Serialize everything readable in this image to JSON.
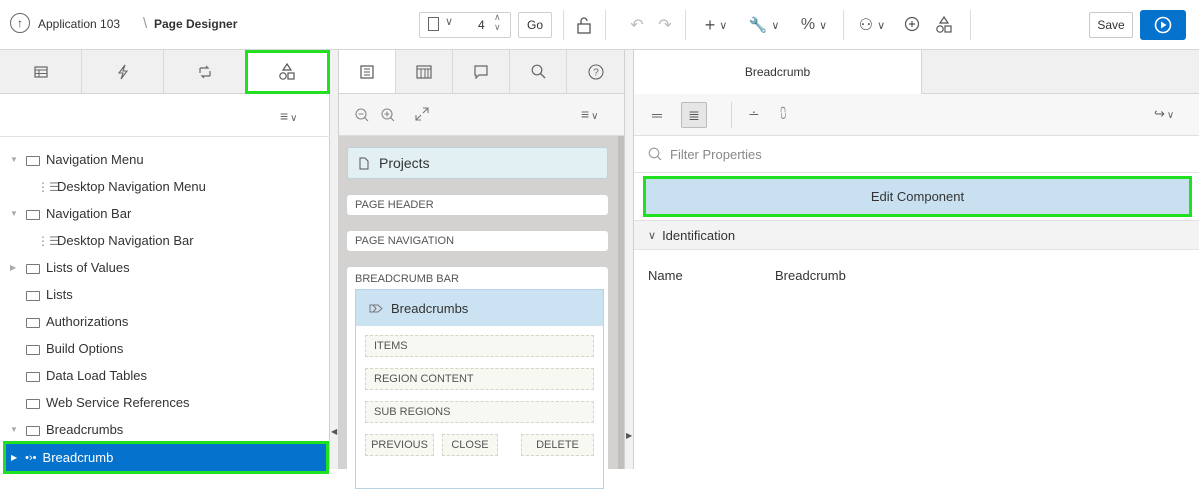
{
  "app": {
    "breadcrumb_app": "Application 103",
    "breadcrumb_sep": "\\",
    "breadcrumb_page": "Page Designer",
    "page_number": "4",
    "go_label": "Go",
    "save_label": "Save"
  },
  "icons": {
    "up": "↑",
    "page": "🗋",
    "chev": "⌄",
    "spin": "⌃⌄",
    "unlock": "🔓",
    "undo": "↶",
    "redo": "↷",
    "create": "+",
    "utilities": "🔧",
    "shared": "%",
    "team": "⚇",
    "comment": "⊕",
    "components": "⚗",
    "run": "▶"
  },
  "left": {
    "tree": [
      {
        "type": "folder",
        "label": "Navigation Menu",
        "expanded": true,
        "indent": 0
      },
      {
        "type": "list",
        "label": "Desktop Navigation Menu",
        "indent": 1
      },
      {
        "type": "folder",
        "label": "Navigation Bar",
        "expanded": true,
        "indent": 0
      },
      {
        "type": "list",
        "label": "Desktop Navigation Bar",
        "indent": 1
      },
      {
        "type": "folder",
        "label": "Lists of Values",
        "expanded": false,
        "indent": 0
      },
      {
        "type": "folder",
        "label": "Lists",
        "indent": 0
      },
      {
        "type": "folder",
        "label": "Authorizations",
        "indent": 0
      },
      {
        "type": "folder",
        "label": "Build Options",
        "indent": 0
      },
      {
        "type": "folder",
        "label": "Data Load Tables",
        "indent": 0
      },
      {
        "type": "folder",
        "label": "Web Service References",
        "indent": 0
      },
      {
        "type": "folder",
        "label": "Breadcrumbs",
        "expanded": true,
        "indent": 0
      },
      {
        "type": "selected",
        "label": "Breadcrumb",
        "indent": 1
      }
    ]
  },
  "middle": {
    "page_title": "Projects",
    "page_header": "PAGE HEADER",
    "page_navigation": "PAGE NAVIGATION",
    "breadcrumb_bar": "BREADCRUMB BAR",
    "region_title": "Breadcrumbs",
    "items": "ITEMS",
    "region_content": "REGION CONTENT",
    "sub_regions": "SUB REGIONS",
    "previous": "PREVIOUS",
    "close": "CLOSE",
    "delete": "DELETE"
  },
  "right": {
    "tab_title": "Breadcrumb",
    "filter_placeholder": "Filter Properties",
    "edit_component": "Edit Component",
    "section_identification": "Identification",
    "prop_name_label": "Name",
    "prop_name_value": "Breadcrumb"
  },
  "colors": {
    "accent": "#0572ce",
    "selected_row": "#0572ce",
    "highlight": "#1fe11f",
    "edit_component_bg": "#c9e0f1"
  }
}
